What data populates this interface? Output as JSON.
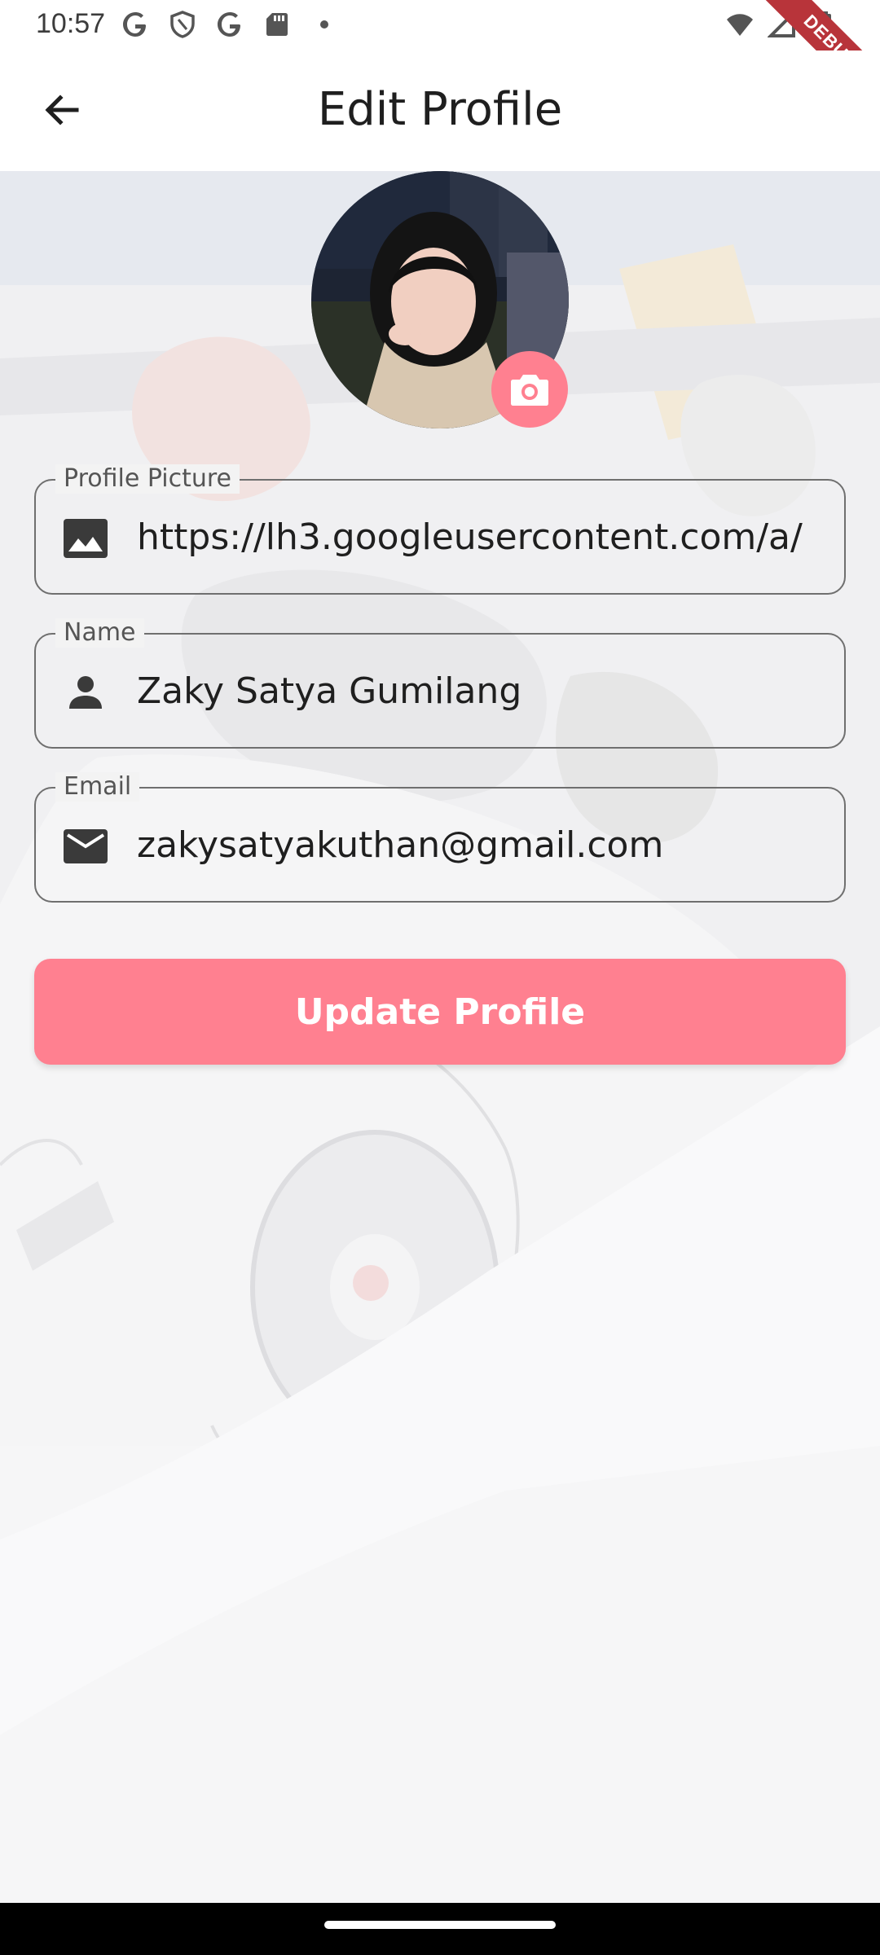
{
  "status_bar": {
    "time": "10:57",
    "left_icons": [
      "google-icon",
      "shield-icon",
      "google-icon",
      "sd-card-icon",
      "dot-icon"
    ],
    "right_icons": [
      "wifi-icon",
      "signal-icon",
      "battery-icon"
    ],
    "debug_banner": "DEBUG"
  },
  "app_bar": {
    "back_icon": "arrow-back-icon",
    "title": "Edit Profile"
  },
  "avatar": {
    "camera_icon": "camera-icon"
  },
  "form": {
    "profile_picture": {
      "label": "Profile Picture",
      "icon": "image-icon",
      "value": "https://lh3.googleusercontent.com/a/"
    },
    "name": {
      "label": "Name",
      "icon": "person-icon",
      "value": "Zaky Satya Gumilang"
    },
    "email": {
      "label": "Email",
      "icon": "mail-icon",
      "value": "zakysatyakuthan@gmail.com"
    },
    "submit_label": "Update Profile"
  },
  "colors": {
    "accent": "#ff8090",
    "text": "#1f1f1f",
    "border": "#6f6f6f"
  }
}
